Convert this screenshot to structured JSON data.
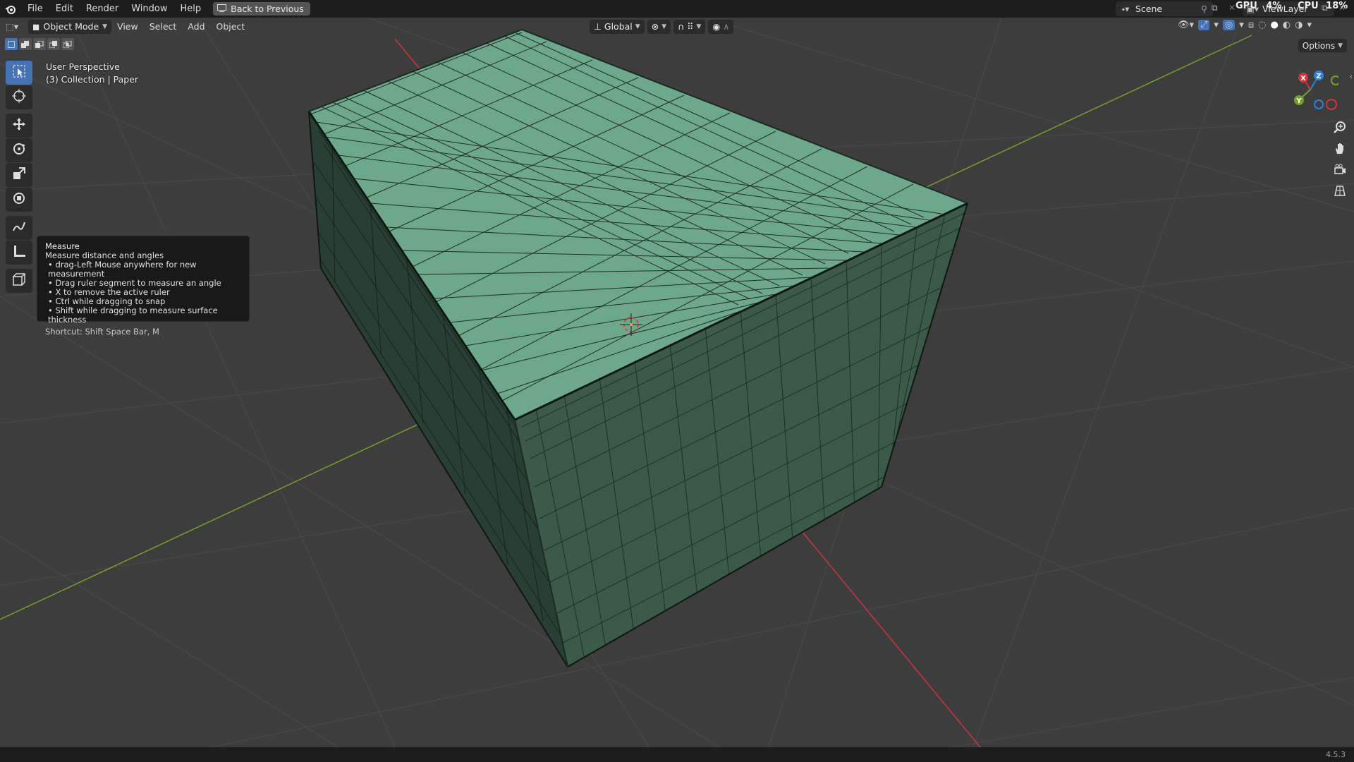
{
  "topbar": {
    "menus": [
      "File",
      "Edit",
      "Render",
      "Window",
      "Help"
    ],
    "back_label": "Back to Previous",
    "scene": "Scene",
    "view_layer": "ViewLayer",
    "gpu_label": "GPU",
    "gpu_value": "4%",
    "cpu_label": "CPU",
    "cpu_value": "18%"
  },
  "viewport_header": {
    "mode": "Object Mode",
    "menus": [
      "View",
      "Select",
      "Add",
      "Object"
    ],
    "orientation": "Global",
    "options_label": "Options"
  },
  "viewport_info": {
    "perspective": "User Perspective",
    "collection": "(3) Collection | Paper"
  },
  "tooltip": {
    "title": "Measure",
    "description": "Measure distance and angles",
    "bullets": [
      "drag-Left Mouse anywhere for new measurement",
      "Drag ruler segment to measure an angle",
      "X to remove the active ruler",
      "Ctrl while dragging to snap",
      "Shift while dragging to measure surface thickness"
    ],
    "shortcut": "Shortcut: Shift Space Bar, M"
  },
  "gizmo": {
    "x": "X",
    "y": "Y",
    "z": "Z"
  },
  "statusbar": {
    "version": "4.5.3"
  },
  "colors": {
    "accent": "#4772b3",
    "mesh": "#6ea88a",
    "x_axis": "#d0343f",
    "y_axis": "#76a02a",
    "z_axis": "#2f7fe0"
  }
}
